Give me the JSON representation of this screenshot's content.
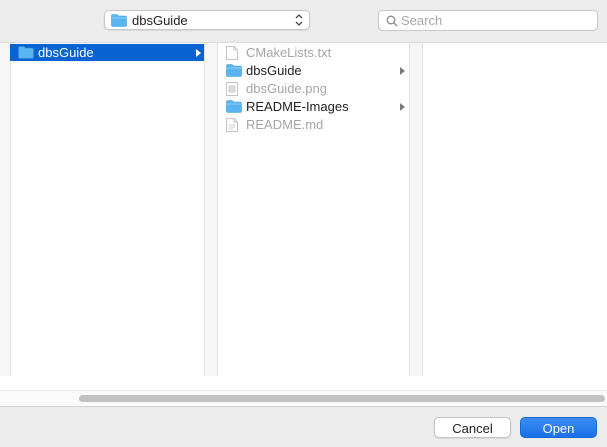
{
  "toolbar": {
    "location": "dbsGuide",
    "search_placeholder": "Search"
  },
  "columns": [
    {
      "items": [
        {
          "label": "dbsGuide",
          "type": "folder",
          "selected": true,
          "has_children": true
        }
      ]
    },
    {
      "items": [
        {
          "label": "CMakeLists.txt",
          "type": "file",
          "dim": true
        },
        {
          "label": "dbsGuide",
          "type": "folder",
          "has_children": true
        },
        {
          "label": "dbsGuide.png",
          "type": "image",
          "dim": true
        },
        {
          "label": "README-Images",
          "type": "folder",
          "has_children": true
        },
        {
          "label": "README.md",
          "type": "file",
          "dim": true
        }
      ]
    }
  ],
  "footer": {
    "cancel_label": "Cancel",
    "open_label": "Open"
  },
  "colors": {
    "selection": "#0a63d2",
    "folder": "#5ab4f0",
    "open_button": "#1a6fe8"
  }
}
